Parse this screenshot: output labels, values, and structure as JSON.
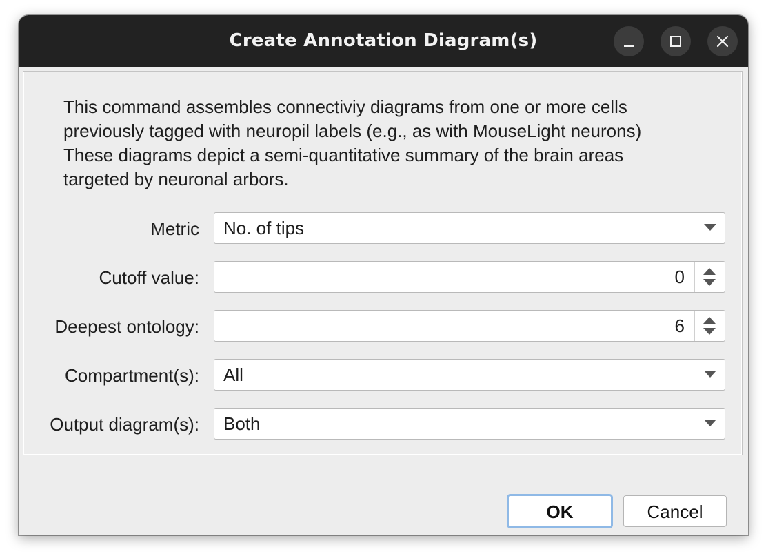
{
  "window": {
    "title": "Create Annotation Diagram(s)"
  },
  "titlebar_buttons": {
    "minimize_icon": "minimize-icon",
    "maximize_icon": "maximize-icon",
    "close_icon": "close-icon"
  },
  "description": {
    "lines": [
      "This command assembles connectiviy diagrams from one or more cells",
      "previously tagged with neuropil labels (e.g., as with MouseLight neurons)",
      "These diagrams depict a semi-quantitative summary of the brain areas",
      "targeted by neuronal arbors."
    ]
  },
  "form": {
    "metric": {
      "label": "Metric",
      "value": "No. of tips"
    },
    "cutoff": {
      "label": "Cutoff value:",
      "value": "0"
    },
    "ontology": {
      "label": "Deepest ontology:",
      "value": "6"
    },
    "compartments": {
      "label": "Compartment(s):",
      "value": "All"
    },
    "output": {
      "label": "Output diagram(s):",
      "value": "Both"
    }
  },
  "buttons": {
    "ok_label": "OK",
    "cancel_label": "Cancel"
  },
  "colors": {
    "titlebar": "#222222",
    "dialog_bg": "#ededed",
    "default_button_focus": "#8fb9e6"
  }
}
